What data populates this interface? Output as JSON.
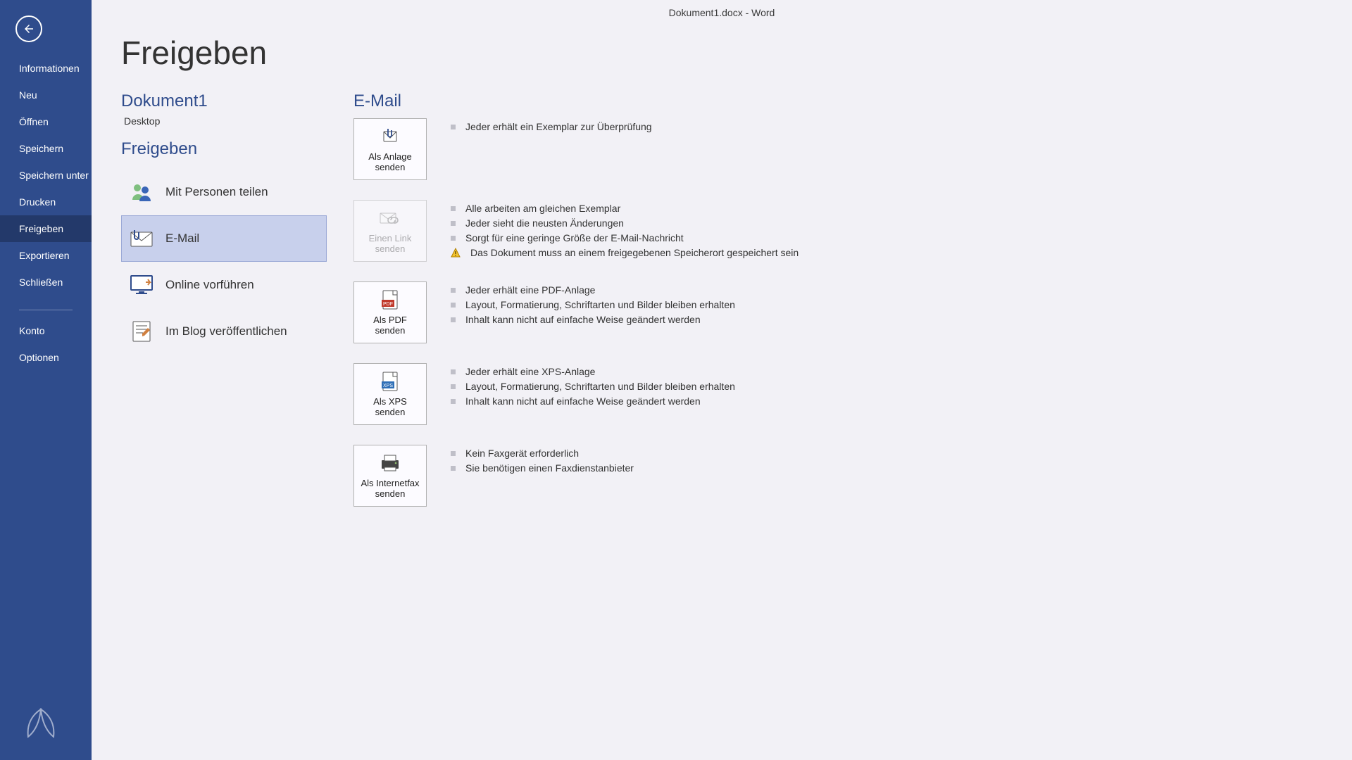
{
  "window_title": "Dokument1.docx - Word",
  "page_title": "Freigeben",
  "sidebar": {
    "back_icon": "arrow-left",
    "items": [
      {
        "label": "Informationen"
      },
      {
        "label": "Neu"
      },
      {
        "label": "Öffnen"
      },
      {
        "label": "Speichern"
      },
      {
        "label": "Speichern unter"
      },
      {
        "label": "Drucken"
      },
      {
        "label": "Freigeben",
        "active": true
      },
      {
        "label": "Exportieren"
      },
      {
        "label": "Schließen"
      }
    ],
    "secondary": [
      {
        "label": "Konto"
      },
      {
        "label": "Optionen"
      }
    ]
  },
  "doc": {
    "name": "Dokument1",
    "location": "Desktop"
  },
  "share_header": "Freigeben",
  "share_options": [
    {
      "label": "Mit Personen teilen",
      "icon": "people"
    },
    {
      "label": "E-Mail",
      "icon": "mail-attach",
      "selected": true
    },
    {
      "label": "Online vorführen",
      "icon": "screen"
    },
    {
      "label": "Im Blog veröffentlichen",
      "icon": "blog"
    }
  ],
  "email": {
    "title": "E-Mail",
    "actions": [
      {
        "label": "Als Anlage senden",
        "icon": "attach",
        "disabled": false,
        "bullets": [
          {
            "text": "Jeder erhält ein Exemplar zur Überprüfung",
            "type": "sq"
          }
        ]
      },
      {
        "label": "Einen Link senden",
        "icon": "link",
        "disabled": true,
        "bullets": [
          {
            "text": "Alle arbeiten am gleichen Exemplar",
            "type": "sq"
          },
          {
            "text": "Jeder sieht die neusten Änderungen",
            "type": "sq"
          },
          {
            "text": "Sorgt für eine geringe Größe der E-Mail-Nachricht",
            "type": "sq"
          },
          {
            "text": "Das Dokument muss an einem freigegebenen Speicherort gespeichert sein",
            "type": "warn"
          }
        ]
      },
      {
        "label": "Als PDF senden",
        "icon": "pdf",
        "disabled": false,
        "bullets": [
          {
            "text": "Jeder erhält eine PDF-Anlage",
            "type": "sq"
          },
          {
            "text": "Layout, Formatierung, Schriftarten und Bilder bleiben erhalten",
            "type": "sq"
          },
          {
            "text": "Inhalt kann nicht auf einfache Weise geändert werden",
            "type": "sq"
          }
        ]
      },
      {
        "label": "Als XPS senden",
        "icon": "xps",
        "disabled": false,
        "bullets": [
          {
            "text": "Jeder erhält eine XPS-Anlage",
            "type": "sq"
          },
          {
            "text": "Layout, Formatierung, Schriftarten und Bilder bleiben erhalten",
            "type": "sq"
          },
          {
            "text": "Inhalt kann nicht auf einfache Weise geändert werden",
            "type": "sq"
          }
        ]
      },
      {
        "label": "Als Internetfax senden",
        "icon": "fax",
        "disabled": false,
        "bullets": [
          {
            "text": "Kein Faxgerät erforderlich",
            "type": "sq"
          },
          {
            "text": "Sie benötigen einen Faxdienstanbieter",
            "type": "sq"
          }
        ]
      }
    ]
  }
}
